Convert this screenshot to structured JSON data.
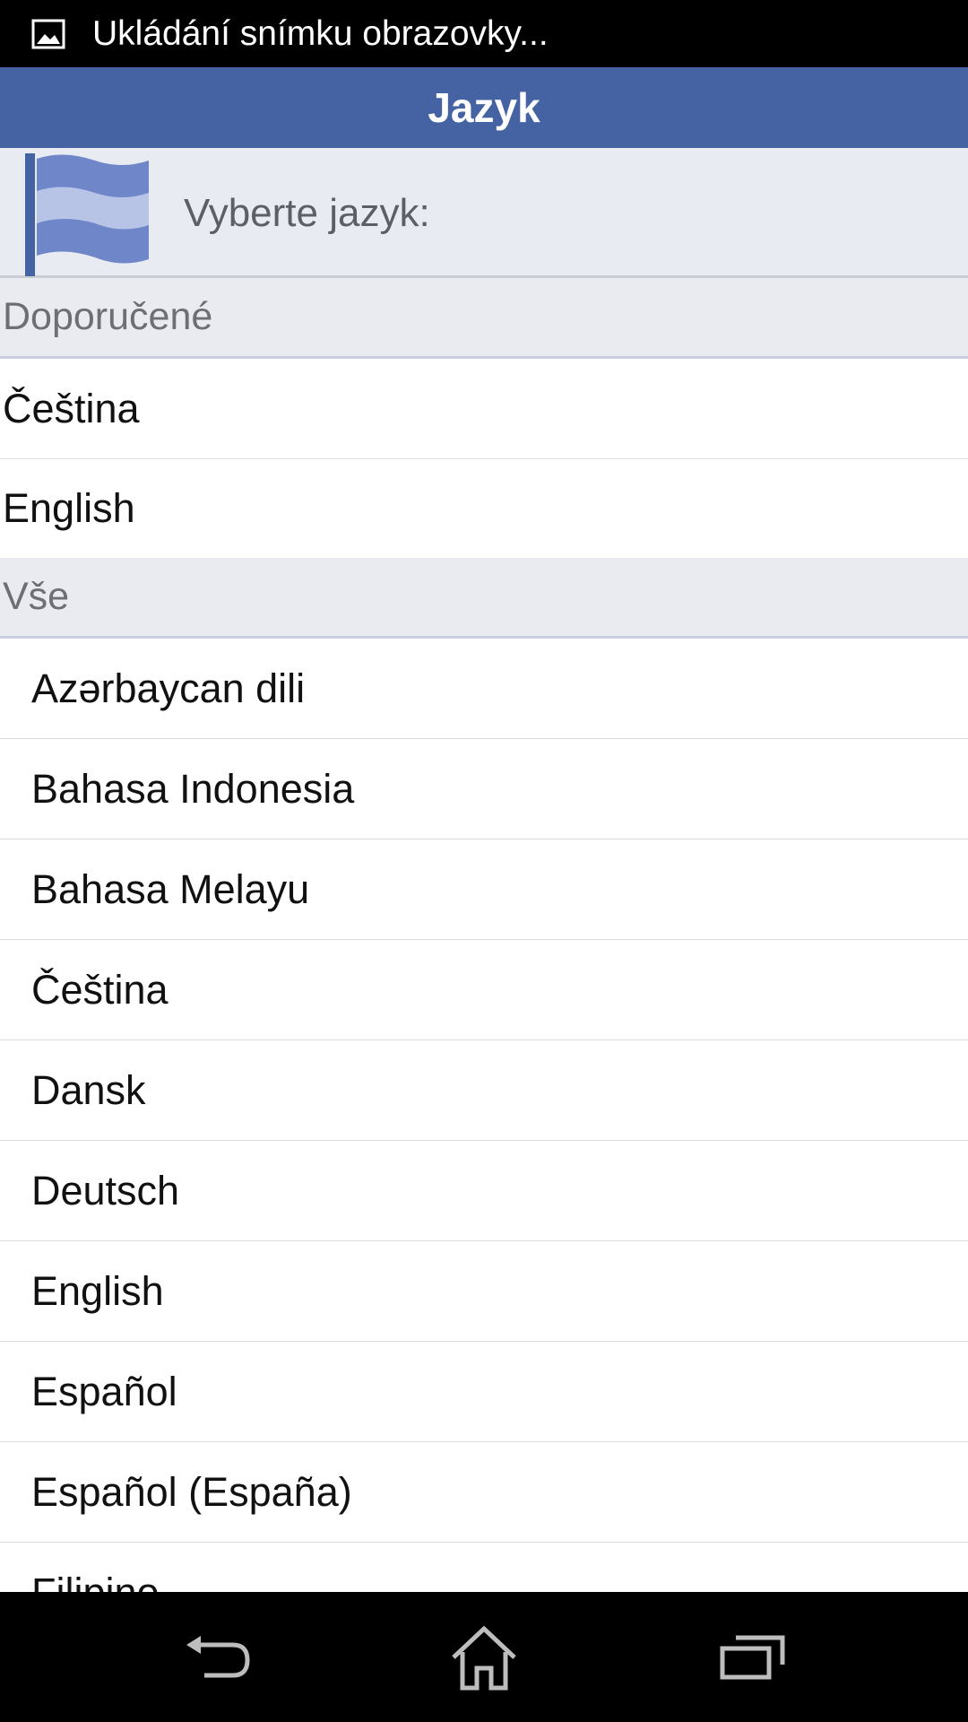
{
  "status_bar": {
    "icon": "image-icon",
    "text": "Ukládání snímku obrazovky..."
  },
  "title_bar": {
    "title": "Jazyk",
    "color": "#4562a2"
  },
  "header": {
    "icon": "flag-icon",
    "prompt": "Vyberte jazyk:"
  },
  "sections": {
    "recommended": {
      "label": "Doporučené",
      "items": [
        "Čeština",
        "English"
      ]
    },
    "all": {
      "label": "Vše",
      "items": [
        "Azərbaycan dili",
        "Bahasa Indonesia",
        "Bahasa Melayu",
        "Čeština",
        "Dansk",
        "Deutsch",
        "English",
        "Español",
        "Español (España)",
        "Filipino"
      ]
    }
  },
  "nav_bar": {
    "back": "back-icon",
    "home": "home-icon",
    "recents": "recents-icon"
  }
}
